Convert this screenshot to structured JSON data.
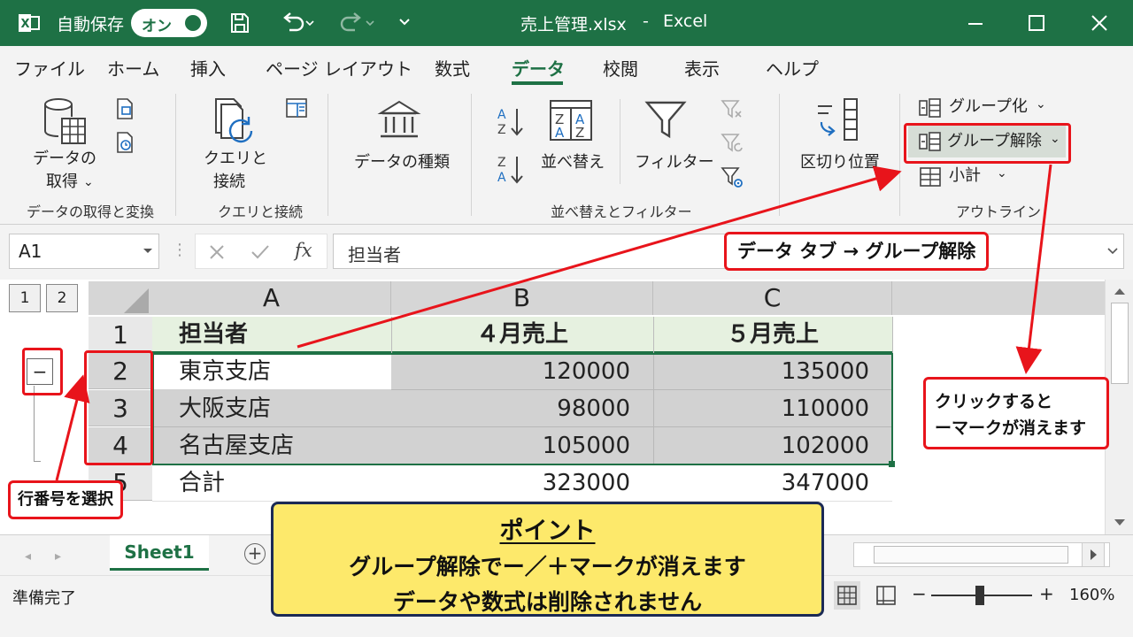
{
  "titlebar": {
    "autosave_label": "自動保存",
    "autosave_state": "オン",
    "doc_title": "売上管理.xlsx",
    "separator": "-",
    "app_name": "Excel"
  },
  "tabs": [
    {
      "label": "ファイル"
    },
    {
      "label": "ホーム"
    },
    {
      "label": "挿入"
    },
    {
      "label": "ページ レイアウト"
    },
    {
      "label": "数式"
    },
    {
      "label": "データ"
    },
    {
      "label": "校閲"
    },
    {
      "label": "表示"
    },
    {
      "label": "ヘルプ"
    }
  ],
  "ribbon": {
    "get_data_line1": "データの",
    "get_data_line2": "取得",
    "group_get_transform": "データの取得と変換",
    "queries_line1": "クエリと",
    "queries_line2": "接続",
    "group_queries": "クエリと接続",
    "data_types": "データの種類",
    "sort": "並べ替え",
    "filter": "フィルター",
    "group_sort_filter": "並べ替えとフィルター",
    "text_to_columns": "区切り位置",
    "group": "グループ化",
    "ungroup": "グループ解除",
    "subtotal": "小計",
    "group_outline": "アウトライン",
    "chev": "⌄"
  },
  "formula_bar": {
    "name_box": "A1",
    "fx": "fx",
    "content": "担当者"
  },
  "outline": {
    "level1": "1",
    "level2": "2",
    "collapse": "−"
  },
  "columns": [
    "A",
    "B",
    "C"
  ],
  "rows": [
    {
      "n": "1",
      "a": "担当者",
      "b": "４月売上",
      "c": "５月売上"
    },
    {
      "n": "2",
      "a": "東京支店",
      "b": "120000",
      "c": "135000"
    },
    {
      "n": "3",
      "a": "大阪支店",
      "b": "98000",
      "c": "110000"
    },
    {
      "n": "4",
      "a": "名古屋支店",
      "b": "105000",
      "c": "102000"
    },
    {
      "n": "5",
      "a": "合計",
      "b": "323000",
      "c": "347000"
    }
  ],
  "sheet": {
    "name": "Sheet1",
    "add": "+"
  },
  "status": {
    "ready": "準備完了",
    "zoom": "160%",
    "minus": "−",
    "plus": "+"
  },
  "annotations": {
    "tab_ungroup": "データ タブ → グループ解除",
    "click_line1": "クリックすると",
    "click_line2": "ーマークが消えます",
    "select_rows": "行番号を選択",
    "point_title": "ポイント",
    "point_line1": "グループ解除でー／＋マークが消えます",
    "point_line2": "データや数式は削除されません"
  },
  "colors": {
    "excel_green": "#1e7145",
    "annot_red": "#e8141b",
    "point_yellow": "#fde96b"
  }
}
